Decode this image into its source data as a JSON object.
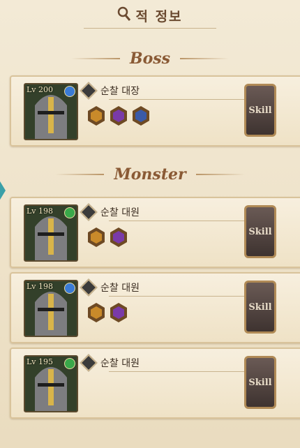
{
  "header": {
    "title": "적 정보",
    "icon": "magnifier-icon"
  },
  "boss_section": {
    "label": "Boss"
  },
  "monster_section": {
    "label": "Monster"
  },
  "cards": [
    {
      "level": "Lv 200",
      "name": "순찰 대장",
      "element_color": "#3a7bd5",
      "skills": [
        "#c98a2a",
        "#7a3aa8",
        "#3a5aa8"
      ],
      "skill_label": "Skill"
    },
    {
      "level": "Lv 198",
      "name": "순찰 대원",
      "element_color": "#3aa84a",
      "skills": [
        "#c98a2a",
        "#7a3aa8"
      ],
      "skill_label": "Skill"
    },
    {
      "level": "Lv 198",
      "name": "순찰 대원",
      "element_color": "#3a7bd5",
      "skills": [
        "#c98a2a",
        "#7a3aa8"
      ],
      "skill_label": "Skill"
    },
    {
      "level": "Lv 195",
      "name": "순찰 대원",
      "element_color": "#3aa84a",
      "skills": [],
      "skill_label": "Skill"
    }
  ]
}
